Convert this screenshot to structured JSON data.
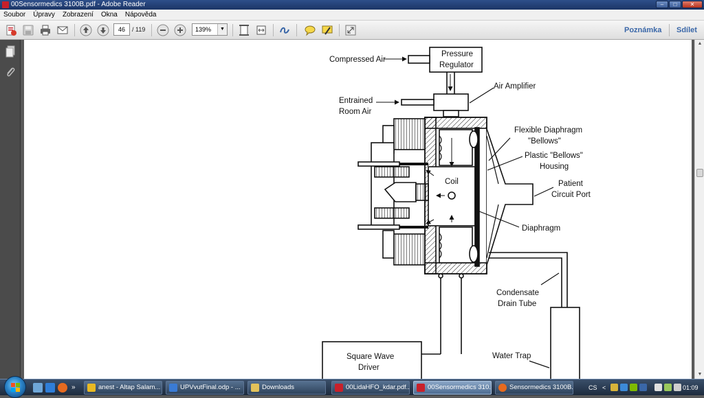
{
  "window": {
    "title": "00Sensormedics 3100B.pdf - Adobe Reader",
    "controls": {
      "minimize": "–",
      "maximize": "□",
      "close": "✕"
    }
  },
  "menu": [
    "Soubor",
    "Úpravy",
    "Zobrazení",
    "Okna",
    "Nápověda"
  ],
  "toolbar": {
    "page_current": "46",
    "page_total": "/ 119",
    "zoom": "139%",
    "comment_link": "Poznámka",
    "share_link": "Sdílet"
  },
  "diagram": {
    "labels": {
      "compressed_air": "Compressed Air",
      "pressure_regulator_1": "Pressure",
      "pressure_regulator_2": "Regulator",
      "air_amplifier": "Air Amplifier",
      "entrained_1": "Entrained",
      "entrained_2": "Room Air",
      "flexible_1": "Flexible Diaphragm",
      "flexible_2": "\"Bellows\"",
      "plastic_1": "Plastic \"Bellows\"",
      "plastic_2": "Housing",
      "coil": "Coil",
      "patient_1": "Patient",
      "patient_2": "Circuit Port",
      "diaphragm": "Diaphragm",
      "condensate_1": "Condensate",
      "condensate_2": "Drain Tube",
      "square_1": "Square Wave",
      "square_2": "Driver",
      "water_trap": "Water Trap"
    }
  },
  "taskbar": {
    "tasks": [
      {
        "label": "anest - Altap Salam...",
        "color": "#e8b923"
      },
      {
        "label": "UPVvutFinal.odp - ...",
        "color": "#3a7bd5"
      },
      {
        "label": "Downloads",
        "color": "#e3c25a"
      },
      {
        "label": "00LidaHFO_kdar.pdf...",
        "color": "#c8202a"
      },
      {
        "label": "00Sensormedics 310...",
        "color": "#c8202a"
      },
      {
        "label": "Sensormedics 3100B...",
        "color": "#e66a1f"
      }
    ],
    "language": "CS",
    "chevron": "<",
    "clock": "01:09"
  }
}
